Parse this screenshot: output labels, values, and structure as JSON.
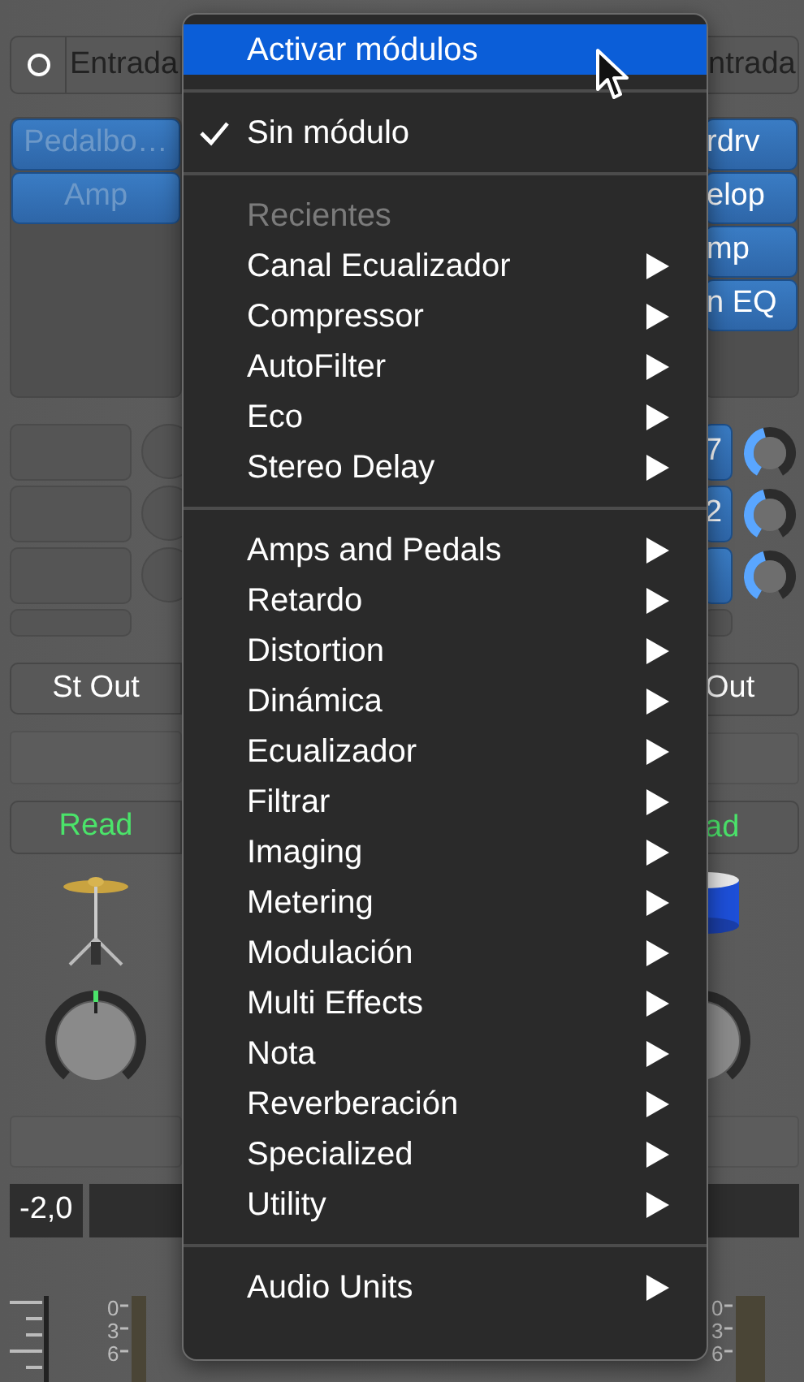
{
  "strips": [
    {
      "input": {
        "label": "Entrada",
        "mono": true
      },
      "plugins": [
        {
          "label": "Pedalbo…",
          "bypassed": true
        },
        {
          "label": "Amp",
          "bypassed": true
        }
      ],
      "sends": [
        {
          "active": false
        },
        {
          "active": false
        },
        {
          "active": false
        }
      ],
      "output": "St Out",
      "automation": "Read",
      "volume": "-2,0",
      "meter_scale": [
        "0",
        "3",
        "6"
      ]
    },
    {
      "input": {
        "label": "ntrada"
      },
      "plugins": [
        {
          "label": "rdrv",
          "bypassed": false
        },
        {
          "label": "elop",
          "bypassed": false
        },
        {
          "label": "mp",
          "bypassed": false
        },
        {
          "label": "n EQ",
          "bypassed": false
        }
      ],
      "sends": [
        {
          "active": true,
          "label": "7"
        },
        {
          "active": true,
          "label": "2"
        },
        {
          "active": true
        }
      ],
      "output": "Out",
      "automation": "ad",
      "meter_scale": [
        "0",
        "3",
        "6"
      ]
    }
  ],
  "menu": {
    "sections": [
      [
        {
          "label": "Activar módulos",
          "kind": "command",
          "selected": true,
          "checked": false
        }
      ],
      [
        {
          "label": "Sin módulo",
          "kind": "command",
          "selected": false,
          "checked": true
        }
      ],
      [
        {
          "label": "Recientes",
          "kind": "header",
          "selected": false,
          "checked": false
        },
        {
          "label": "Canal Ecualizador",
          "kind": "submenu",
          "selected": false,
          "checked": false
        },
        {
          "label": "Compressor",
          "kind": "submenu",
          "selected": false,
          "checked": false
        },
        {
          "label": "AutoFilter",
          "kind": "submenu",
          "selected": false,
          "checked": false
        },
        {
          "label": "Eco",
          "kind": "submenu",
          "selected": false,
          "checked": false
        },
        {
          "label": "Stereo Delay",
          "kind": "submenu",
          "selected": false,
          "checked": false
        }
      ],
      [
        {
          "label": "Amps and Pedals",
          "kind": "submenu",
          "selected": false,
          "checked": false
        },
        {
          "label": "Retardo",
          "kind": "submenu",
          "selected": false,
          "checked": false
        },
        {
          "label": "Distortion",
          "kind": "submenu",
          "selected": false,
          "checked": false
        },
        {
          "label": "Dinámica",
          "kind": "submenu",
          "selected": false,
          "checked": false
        },
        {
          "label": "Ecualizador",
          "kind": "submenu",
          "selected": false,
          "checked": false
        },
        {
          "label": "Filtrar",
          "kind": "submenu",
          "selected": false,
          "checked": false
        },
        {
          "label": "Imaging",
          "kind": "submenu",
          "selected": false,
          "checked": false
        },
        {
          "label": "Metering",
          "kind": "submenu",
          "selected": false,
          "checked": false
        },
        {
          "label": "Modulación",
          "kind": "submenu",
          "selected": false,
          "checked": false
        },
        {
          "label": "Multi Effects",
          "kind": "submenu",
          "selected": false,
          "checked": false
        },
        {
          "label": "Nota",
          "kind": "submenu",
          "selected": false,
          "checked": false
        },
        {
          "label": "Reverberación",
          "kind": "submenu",
          "selected": false,
          "checked": false
        },
        {
          "label": "Specialized",
          "kind": "submenu",
          "selected": false,
          "checked": false
        },
        {
          "label": "Utility",
          "kind": "submenu",
          "selected": false,
          "checked": false
        }
      ],
      [
        {
          "label": "Audio Units",
          "kind": "submenu",
          "selected": false,
          "checked": false
        }
      ]
    ]
  }
}
